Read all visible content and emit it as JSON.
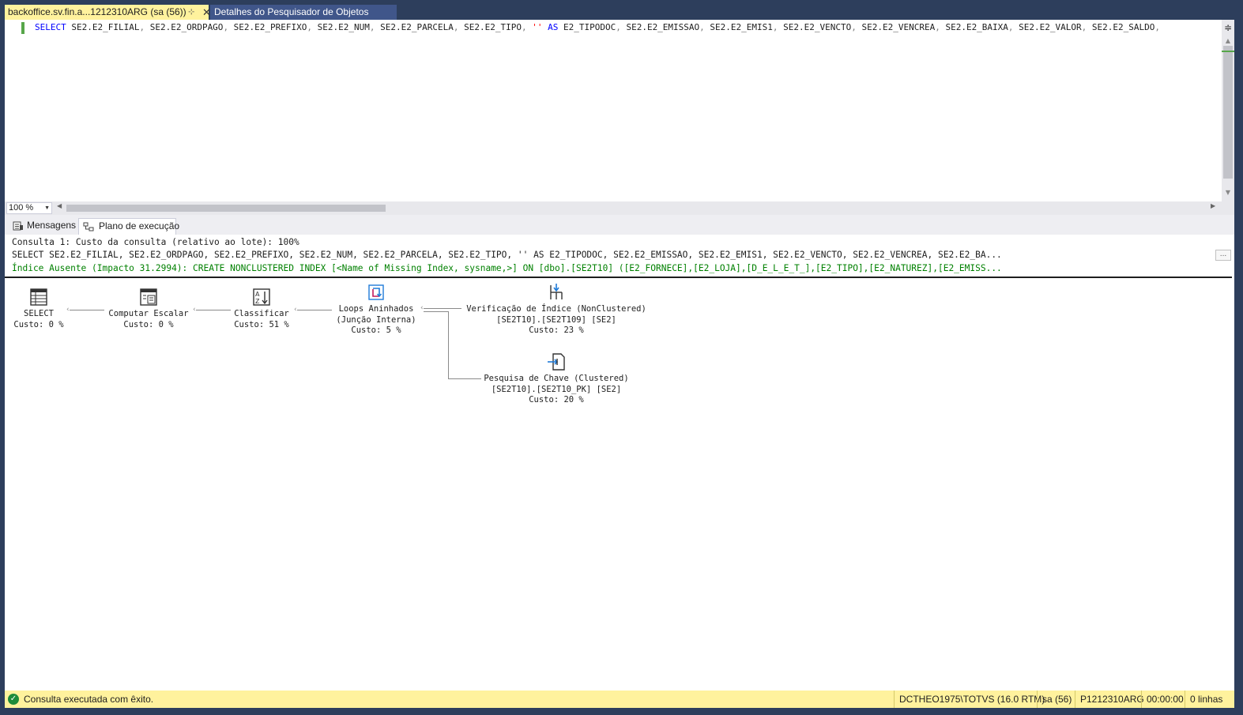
{
  "tabs": {
    "active": "backoffice.sv.fin.a...1212310ARG (sa (56))",
    "pin_icon": "pin-icon",
    "close_icon": "close-icon",
    "inactive": "Detalhes do Pesquisador de Objetos"
  },
  "editor": {
    "tokens": [
      {
        "t": "SELECT",
        "c": "kw"
      },
      {
        "t": " SE2.E2_FILIAL",
        "c": "ident"
      },
      {
        "t": ",",
        "c": "gr"
      },
      {
        "t": " SE2.E2_ORDPAGO",
        "c": "ident"
      },
      {
        "t": ",",
        "c": "gr"
      },
      {
        "t": " SE2.E2_PREFIXO",
        "c": "ident"
      },
      {
        "t": ",",
        "c": "gr"
      },
      {
        "t": " SE2.E2_NUM",
        "c": "ident"
      },
      {
        "t": ",",
        "c": "gr"
      },
      {
        "t": " SE2.E2_PARCELA",
        "c": "ident"
      },
      {
        "t": ",",
        "c": "gr"
      },
      {
        "t": " SE2.E2_TIPO",
        "c": "ident"
      },
      {
        "t": ",",
        "c": "gr"
      },
      {
        "t": " ''",
        "c": "str"
      },
      {
        "t": " AS",
        "c": "kw"
      },
      {
        "t": " E2_TIPODOC",
        "c": "ident"
      },
      {
        "t": ",",
        "c": "gr"
      },
      {
        "t": " SE2.E2_EMISSAO",
        "c": "ident"
      },
      {
        "t": ",",
        "c": "gr"
      },
      {
        "t": " SE2.E2_EMIS1",
        "c": "ident"
      },
      {
        "t": ",",
        "c": "gr"
      },
      {
        "t": " SE2.E2_VENCTO",
        "c": "ident"
      },
      {
        "t": ",",
        "c": "gr"
      },
      {
        "t": " SE2.E2_VENCREA",
        "c": "ident"
      },
      {
        "t": ",",
        "c": "gr"
      },
      {
        "t": " SE2.E2_BAIXA",
        "c": "ident"
      },
      {
        "t": ",",
        "c": "gr"
      },
      {
        "t": " SE2.E2_VALOR",
        "c": "ident"
      },
      {
        "t": ",",
        "c": "gr"
      },
      {
        "t": " SE2.E2_SALDO",
        "c": "ident"
      },
      {
        "t": ",",
        "c": "gr"
      }
    ],
    "zoom": "100 %"
  },
  "result_tabs": {
    "messages": "Mensagens",
    "plan": "Plano de execução"
  },
  "plan": {
    "query_header": "Consulta 1: Custo da consulta (relativo ao lote): 100%",
    "query_text": "SELECT SE2.E2_FILIAL, SE2.E2_ORDPAGO, SE2.E2_PREFIXO, SE2.E2_NUM, SE2.E2_PARCELA, SE2.E2_TIPO, '' AS E2_TIPODOC, SE2.E2_EMISSAO, SE2.E2_EMIS1, SE2.E2_VENCTO, SE2.E2_VENCREA, SE2.E2_BA...",
    "missing_index": "Índice Ausente (Impacto 31.2994): CREATE NONCLUSTERED INDEX [<Name of Missing Index, sysname,>] ON [dbo].[SE2T10] ([E2_FORNECE],[E2_LOJA],[D_E_L_E_T_],[E2_TIPO],[E2_NATUREZ],[E2_EMISS...",
    "more_button": "...",
    "nodes": {
      "select": {
        "line1": "SELECT",
        "line2": "Custo: 0 %",
        "icon": "select-result-icon"
      },
      "compute": {
        "line1": "Computar Escalar",
        "line2": "Custo: 0 %",
        "icon": "compute-scalar-icon"
      },
      "sort": {
        "line1": "Classificar",
        "line2": "Custo: 51 %",
        "icon": "sort-icon"
      },
      "loops": {
        "line1": "Loops Aninhados",
        "line2": "(Junção Interna)",
        "line3": "Custo: 5 %",
        "icon": "nested-loops-icon"
      },
      "index_seek": {
        "line1": "Verificação de Índice (NonClustered)",
        "line2": "[SE2T10].[SE2T109] [SE2]",
        "line3": "Custo: 23 %",
        "icon": "index-seek-icon"
      },
      "key_lookup": {
        "line1": "Pesquisa de Chave (Clustered)",
        "line2": "[SE2T10].[SE2T10_PK] [SE2]",
        "line3": "Custo: 20 %",
        "icon": "key-lookup-icon"
      }
    }
  },
  "status": {
    "message": "Consulta executada com êxito.",
    "server": "DCTHEO1975\\TOTVS (16.0 RTM)",
    "user": "sa (56)",
    "database": "P1212310ARG",
    "elapsed": "00:00:00",
    "rows": "0 linhas"
  },
  "colors": {
    "chrome": "#2d3e5c",
    "active_tab": "#fff29d",
    "inactive_tab": "#40568a",
    "keyword": "#0000ff",
    "string": "#ff0000",
    "missing_index": "#008000",
    "success": "#1e8c3a"
  }
}
